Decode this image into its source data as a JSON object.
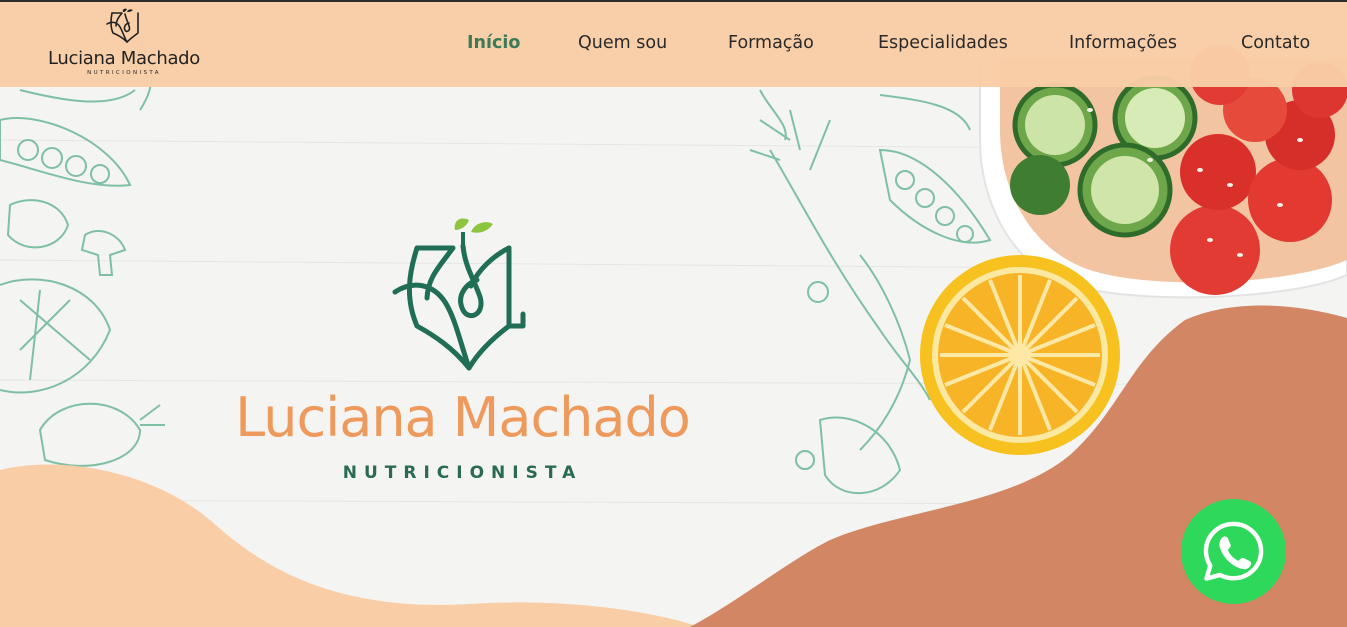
{
  "brand": {
    "name": "Luciana Machado",
    "subtitle": "NUTRICIONISTA"
  },
  "nav": {
    "items": [
      {
        "label": "Início",
        "active": true
      },
      {
        "label": "Quem sou",
        "active": false
      },
      {
        "label": "Formação",
        "active": false
      },
      {
        "label": "Especialidades",
        "active": false
      },
      {
        "label": "Informações",
        "active": false
      },
      {
        "label": "Contato",
        "active": false
      }
    ]
  },
  "hero": {
    "title": "Luciana Machado",
    "subtitle": "NUTRICIONISTA"
  },
  "icons": {
    "whatsapp": "whatsapp-icon"
  },
  "colors": {
    "header_bg": "#f9cda6",
    "nav_active": "#3d7a57",
    "brand_orange": "#ef9a5d",
    "brand_green": "#2a6a55",
    "wave_peach": "#f9cda6",
    "wave_terracotta": "#d28663",
    "whatsapp_green": "#2ed85a"
  }
}
